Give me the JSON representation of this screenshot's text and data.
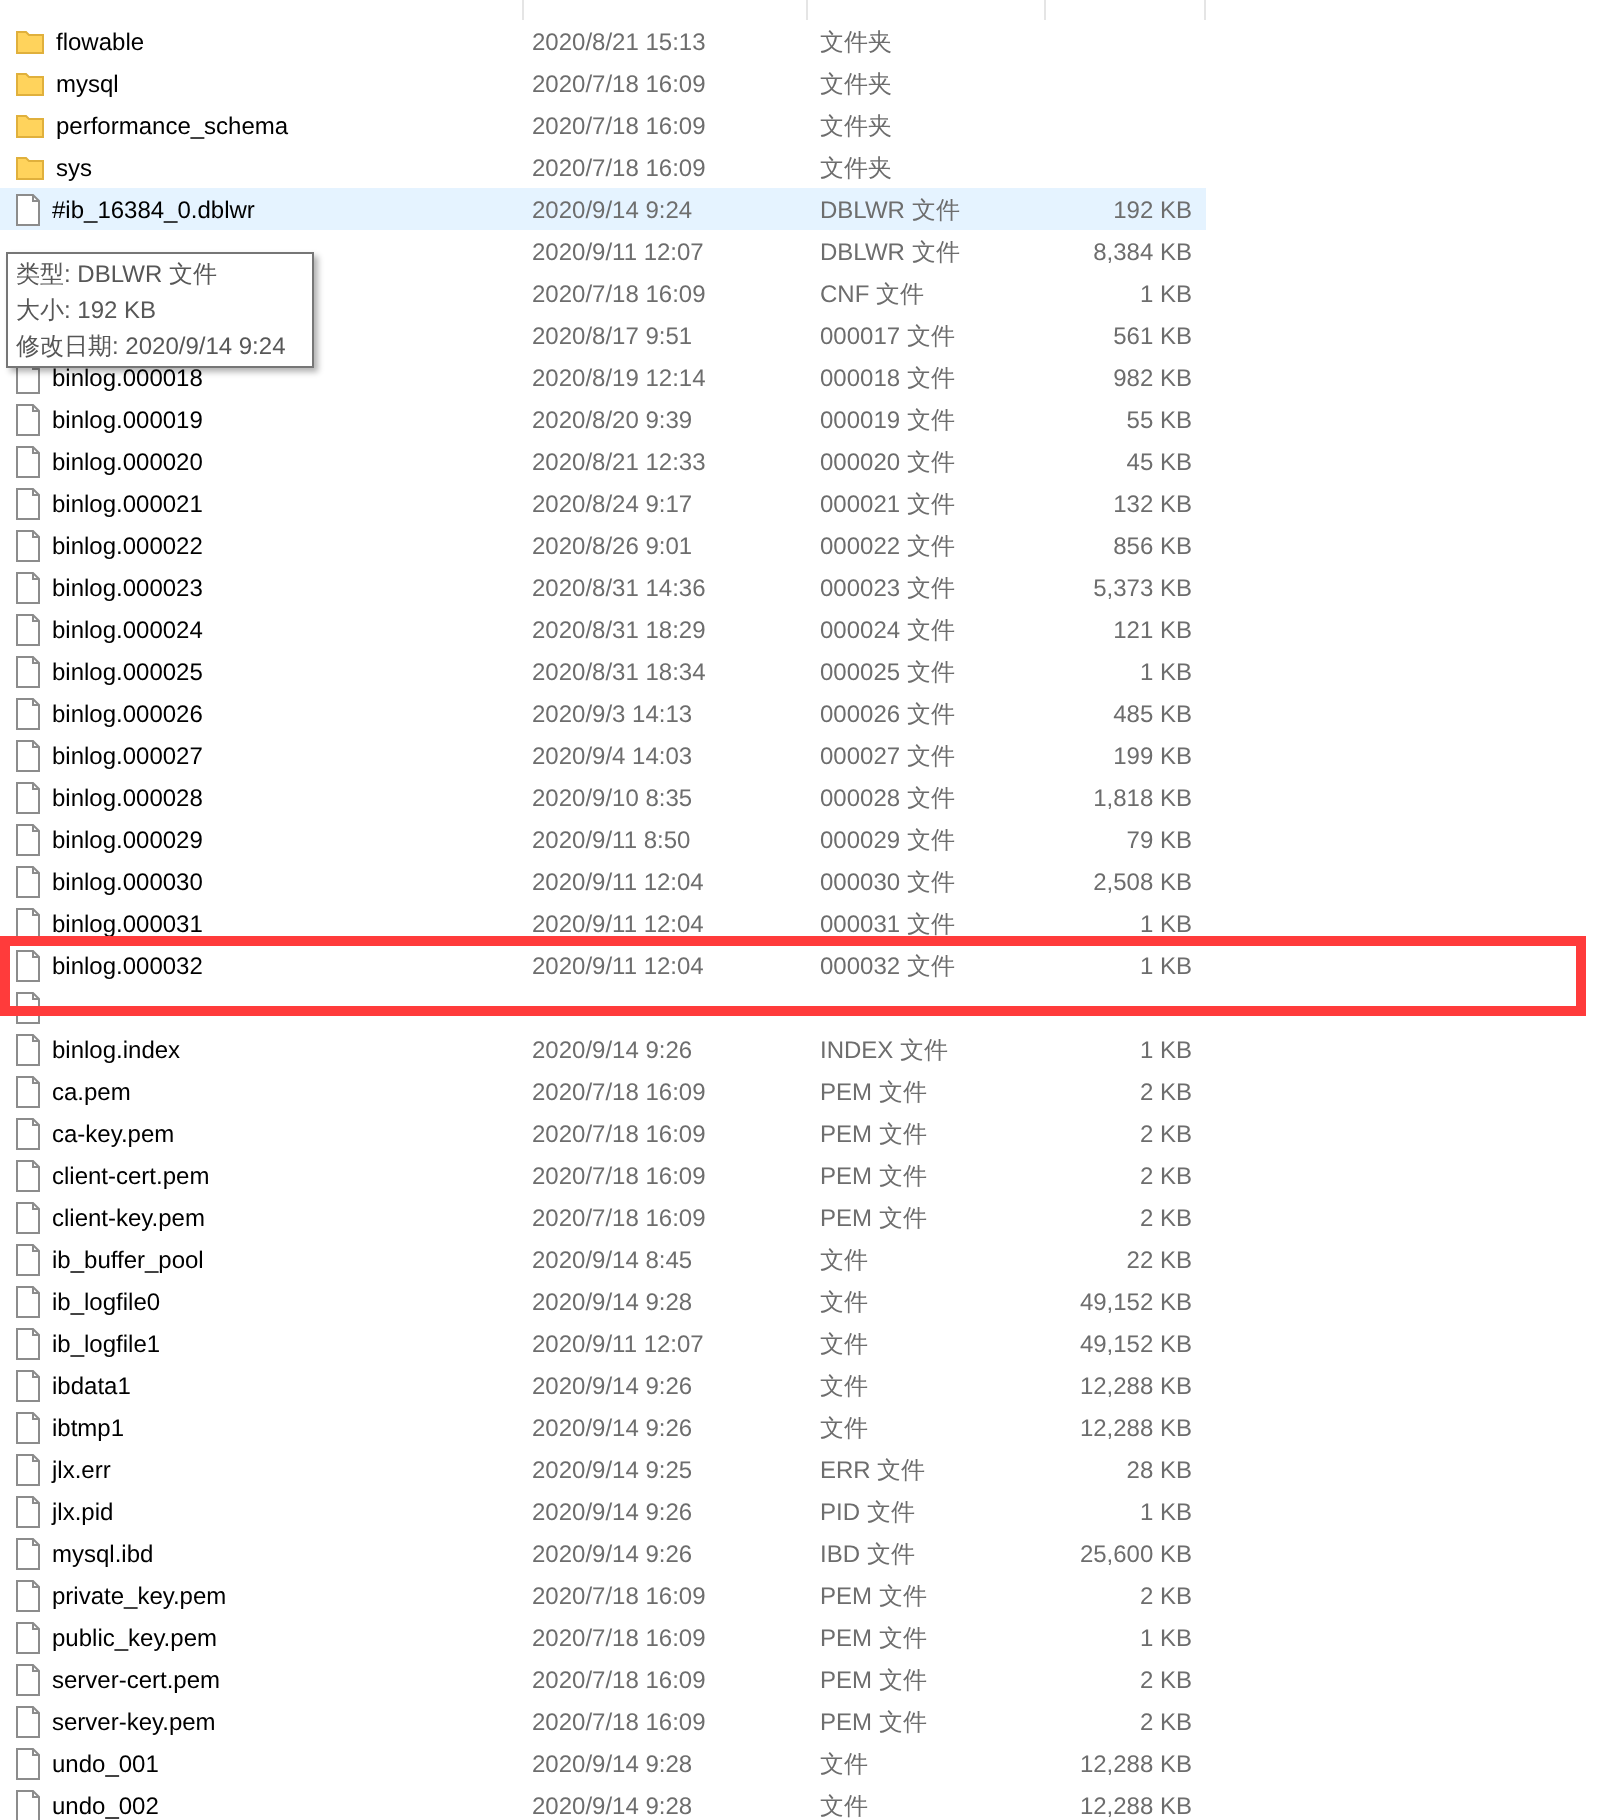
{
  "rows": [
    {
      "kind": "folder",
      "name": "flowable",
      "date": "2020/8/21 15:13",
      "type": "文件夹",
      "hovered": false
    },
    {
      "kind": "folder",
      "name": "mysql",
      "date": "2020/7/18 16:09",
      "type": "文件夹",
      "hovered": false
    },
    {
      "kind": "folder",
      "name": "performance_schema",
      "date": "2020/7/18 16:09",
      "type": "文件夹",
      "hovered": false
    },
    {
      "kind": "folder",
      "name": "sys",
      "date": "2020/7/18 16:09",
      "type": "文件夹",
      "hovered": false
    },
    {
      "kind": "file",
      "name": "#ib_16384_0.dblwr",
      "date": "2020/9/14 9:24",
      "type": "DBLWR 文件",
      "size": "192 KB",
      "hovered": true
    },
    {
      "date": "2020/9/11 12:07",
      "type": "DBLWR 文件",
      "size": "8,384 KB",
      "hovered": false
    },
    {
      "date": "2020/7/18 16:09",
      "type": "CNF 文件",
      "size": "1 KB",
      "hovered": false
    },
    {
      "date": "2020/8/17 9:51",
      "type": "000017 文件",
      "size": "561 KB",
      "hovered": false
    },
    {
      "kind": "file",
      "name": "binlog.000018",
      "date": "2020/8/19 12:14",
      "type": "000018 文件",
      "size": "982 KB",
      "hovered": false
    },
    {
      "kind": "file",
      "name": "binlog.000019",
      "date": "2020/8/20 9:39",
      "type": "000019 文件",
      "size": "55 KB",
      "hovered": false
    },
    {
      "kind": "file",
      "name": "binlog.000020",
      "date": "2020/8/21 12:33",
      "type": "000020 文件",
      "size": "45 KB",
      "hovered": false
    },
    {
      "kind": "file",
      "name": "binlog.000021",
      "date": "2020/8/24 9:17",
      "type": "000021 文件",
      "size": "132 KB",
      "hovered": false
    },
    {
      "kind": "file",
      "name": "binlog.000022",
      "date": "2020/8/26 9:01",
      "type": "000022 文件",
      "size": "856 KB",
      "hovered": false
    },
    {
      "kind": "file",
      "name": "binlog.000023",
      "date": "2020/8/31 14:36",
      "type": "000023 文件",
      "size": "5,373 KB",
      "hovered": false
    },
    {
      "kind": "file",
      "name": "binlog.000024",
      "date": "2020/8/31 18:29",
      "type": "000024 文件",
      "size": "121 KB",
      "hovered": false
    },
    {
      "kind": "file",
      "name": "binlog.000025",
      "date": "2020/8/31 18:34",
      "type": "000025 文件",
      "size": "1 KB",
      "hovered": false
    },
    {
      "kind": "file",
      "name": "binlog.000026",
      "date": "2020/9/3 14:13",
      "type": "000026 文件",
      "size": "485 KB",
      "hovered": false
    },
    {
      "kind": "file",
      "name": "binlog.000027",
      "date": "2020/9/4 14:03",
      "type": "000027 文件",
      "size": "199 KB",
      "hovered": false
    },
    {
      "kind": "file",
      "name": "binlog.000028",
      "date": "2020/9/10 8:35",
      "type": "000028 文件",
      "size": "1,818 KB",
      "hovered": false
    },
    {
      "kind": "file",
      "name": "binlog.000029",
      "date": "2020/9/11 8:50",
      "type": "000029 文件",
      "size": "79 KB",
      "hovered": false
    },
    {
      "kind": "file",
      "name": "binlog.000030",
      "date": "2020/9/11 12:04",
      "type": "000030 文件",
      "size": "2,508 KB",
      "hovered": false
    },
    {
      "kind": "file",
      "name": "binlog.000031",
      "date": "2020/9/11 12:04",
      "type": "000031 文件",
      "size": "1 KB",
      "hovered": false
    },
    {
      "kind": "file",
      "name": "binlog.000032",
      "date": "2020/9/11 12:04",
      "type": "000032 文件",
      "size": "1 KB",
      "hovered": false,
      "highlighted": true
    },
    {
      "kind": "file",
      "hovered": false
    },
    {
      "kind": "file",
      "name": "binlog.index",
      "date": "2020/9/14 9:26",
      "type": "INDEX 文件",
      "size": "1 KB",
      "hovered": false
    },
    {
      "kind": "file",
      "name": "ca.pem",
      "date": "2020/7/18 16:09",
      "type": "PEM 文件",
      "size": "2 KB",
      "hovered": false
    },
    {
      "kind": "file",
      "name": "ca-key.pem",
      "date": "2020/7/18 16:09",
      "type": "PEM 文件",
      "size": "2 KB",
      "hovered": false
    },
    {
      "kind": "file",
      "name": "client-cert.pem",
      "date": "2020/7/18 16:09",
      "type": "PEM 文件",
      "size": "2 KB",
      "hovered": false
    },
    {
      "kind": "file",
      "name": "client-key.pem",
      "date": "2020/7/18 16:09",
      "type": "PEM 文件",
      "size": "2 KB",
      "hovered": false
    },
    {
      "kind": "file",
      "name": "ib_buffer_pool",
      "date": "2020/9/14 8:45",
      "type": "文件",
      "size": "22 KB",
      "hovered": false
    },
    {
      "kind": "file",
      "name": "ib_logfile0",
      "date": "2020/9/14 9:28",
      "type": "文件",
      "size": "49,152 KB",
      "hovered": false
    },
    {
      "kind": "file",
      "name": "ib_logfile1",
      "date": "2020/9/11 12:07",
      "type": "文件",
      "size": "49,152 KB",
      "hovered": false
    },
    {
      "kind": "file",
      "name": "ibdata1",
      "date": "2020/9/14 9:26",
      "type": "文件",
      "size": "12,288 KB",
      "hovered": false
    },
    {
      "kind": "file",
      "name": "ibtmp1",
      "date": "2020/9/14 9:26",
      "type": "文件",
      "size": "12,288 KB",
      "hovered": false
    },
    {
      "kind": "file",
      "name": "jlx.err",
      "date": "2020/9/14 9:25",
      "type": "ERR 文件",
      "size": "28 KB",
      "hovered": false
    },
    {
      "kind": "file",
      "name": "jlx.pid",
      "date": "2020/9/14 9:26",
      "type": "PID 文件",
      "size": "1 KB",
      "hovered": false
    },
    {
      "kind": "file",
      "name": "mysql.ibd",
      "date": "2020/9/14 9:26",
      "type": "IBD 文件",
      "size": "25,600 KB",
      "hovered": false
    },
    {
      "kind": "file",
      "name": "private_key.pem",
      "date": "2020/7/18 16:09",
      "type": "PEM 文件",
      "size": "2 KB",
      "hovered": false
    },
    {
      "kind": "file",
      "name": "public_key.pem",
      "date": "2020/7/18 16:09",
      "type": "PEM 文件",
      "size": "1 KB",
      "hovered": false
    },
    {
      "kind": "file",
      "name": "server-cert.pem",
      "date": "2020/7/18 16:09",
      "type": "PEM 文件",
      "size": "2 KB",
      "hovered": false
    },
    {
      "kind": "file",
      "name": "server-key.pem",
      "date": "2020/7/18 16:09",
      "type": "PEM 文件",
      "size": "2 KB",
      "hovered": false
    },
    {
      "kind": "file",
      "name": "undo_001",
      "date": "2020/9/14 9:28",
      "type": "文件",
      "size": "12,288 KB",
      "hovered": false
    },
    {
      "kind": "file",
      "name": "undo_002",
      "date": "2020/9/14 9:28",
      "type": "文件",
      "size": "12,288 KB",
      "hovered": false
    }
  ],
  "tooltip": {
    "lines": [
      "类型: DBLWR 文件",
      "大小: 192 KB",
      "修改日期: 2020/9/14 9:24"
    ]
  }
}
